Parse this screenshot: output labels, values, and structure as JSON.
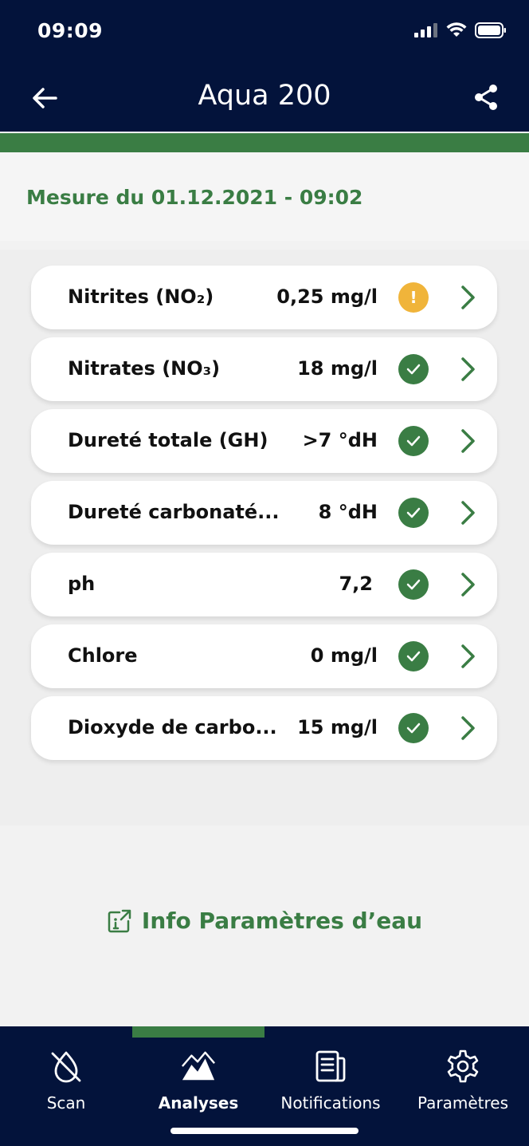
{
  "status_bar": {
    "time": "09:09"
  },
  "header": {
    "title": "Aqua 200",
    "back_icon": "arrow-left-icon",
    "share_icon": "share-icon"
  },
  "measure": {
    "label": "Mesure du 01.12.2021 - 09:02"
  },
  "parameters": [
    {
      "name": "Nitrites (NO₂)",
      "value": "0,25 mg/l",
      "status": "warning",
      "status_symbol": "!"
    },
    {
      "name": "Nitrates (NO₃)",
      "value": "18 mg/l",
      "status": "ok"
    },
    {
      "name": "Dureté totale (GH)",
      "value": ">7 °dH",
      "status": "ok"
    },
    {
      "name": "Dureté carbonaté...",
      "value": "8 °dH",
      "status": "ok"
    },
    {
      "name": "ph",
      "value": "7,2",
      "status": "ok"
    },
    {
      "name": "Chlore",
      "value": "0 mg/l",
      "status": "ok"
    },
    {
      "name": "Dioxyde de carbo...",
      "value": "15 mg/l",
      "status": "ok"
    }
  ],
  "info_link": {
    "label": "Info Paramètres d’eau",
    "icon": "external-info-icon"
  },
  "tabs": [
    {
      "label": "Scan",
      "icon": "droplet-slash-icon",
      "active": false
    },
    {
      "label": "Analyses",
      "icon": "mountain-chart-icon",
      "active": true
    },
    {
      "label": "Notifications",
      "icon": "newspaper-icon",
      "active": false
    },
    {
      "label": "Paramètres",
      "icon": "gear-icon",
      "active": false
    }
  ],
  "colors": {
    "navy": "#03133b",
    "green": "#3a7d44",
    "warning": "#f0b43a",
    "background": "#f2f2f2"
  }
}
